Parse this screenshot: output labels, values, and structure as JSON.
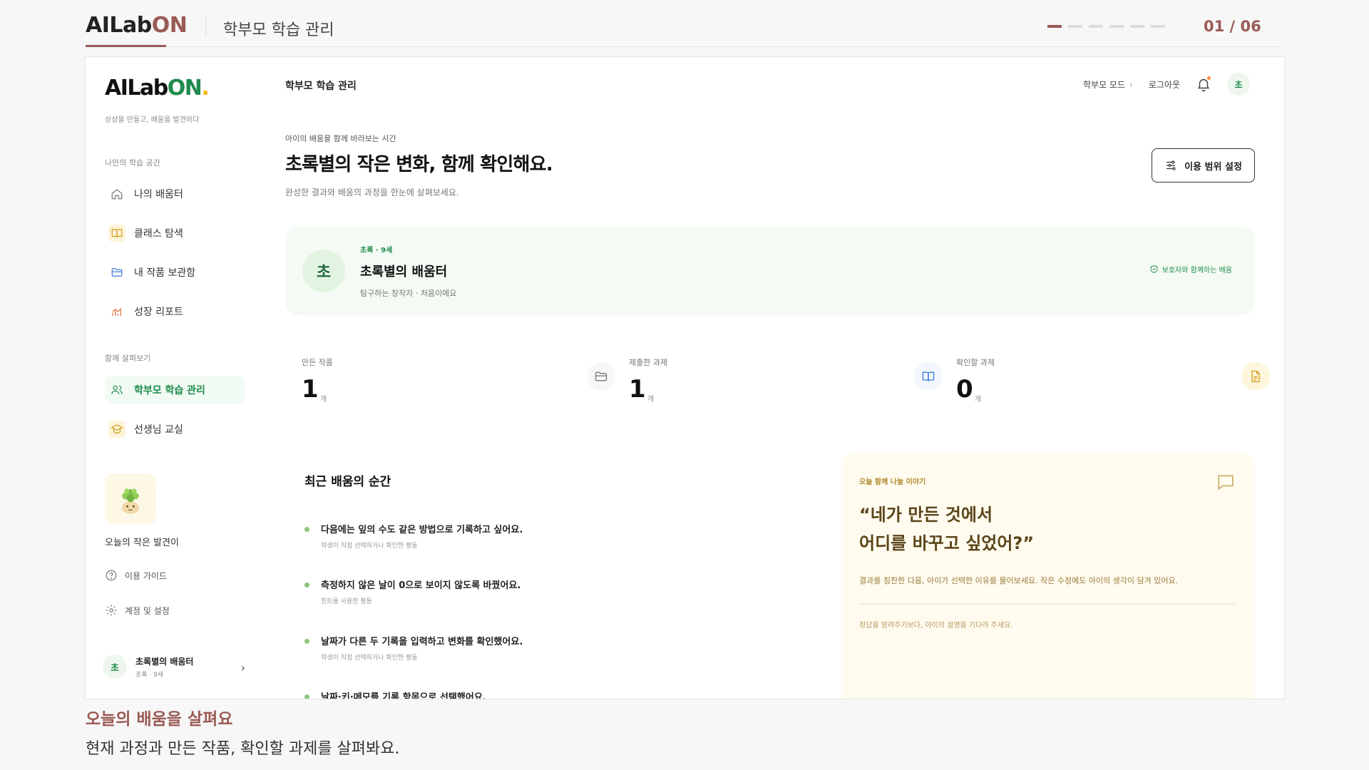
{
  "deck": {
    "brand_prefix": "AILab",
    "brand_suffix": "ON",
    "title": "학부모 학습 관리",
    "page_indicator": "01 / 06",
    "total_pages": 6,
    "current_page": 1
  },
  "sidebar": {
    "logo_prefix": "AILab",
    "logo_suffix": "ON",
    "logo_dot": ".",
    "tagline": "상상을 만들고, 배움을 발견하다",
    "section1_label": "나만의 학습 공간",
    "section2_label": "함께 살펴보기",
    "items": [
      {
        "label": "나의 배움터",
        "icon": "home-icon"
      },
      {
        "label": "클래스 탐색",
        "icon": "book-icon"
      },
      {
        "label": "내 작품 보관함",
        "icon": "folder-icon"
      },
      {
        "label": "성장 리포트",
        "icon": "chart-icon"
      },
      {
        "label": "학부모 학습 관리",
        "icon": "users-icon",
        "active": true
      },
      {
        "label": "선생님 교실",
        "icon": "graduation-cap-icon"
      }
    ],
    "discovery_label": "오늘의 작은 발견이",
    "guide_label": "이용 가이드",
    "settings_label": "계정 및 설정",
    "profile": {
      "avatar": "초",
      "name": "초록별의 배움터",
      "sub": "초록 · 9세"
    }
  },
  "topbar": {
    "title": "학부모 학습 관리",
    "mode_label": "학부모 모드",
    "logout_label": "로그아웃",
    "avatar": "초"
  },
  "hero": {
    "eyebrow": "아이의 배움을 함께 바라보는 시간",
    "headline": "초록별의 작은 변화, 함께 확인해요.",
    "subline": "완성한 결과와 배움의 과정을 한눈에 살펴보세요.",
    "scope_button": "이용 범위 설정"
  },
  "child": {
    "avatar": "초",
    "meta": "초록 · 9세",
    "name": "초록별의 배움터",
    "desc": "탐구하는 창작자 · 처음이에요",
    "badge": "보호자와 함께하는 배움"
  },
  "stats": [
    {
      "label": "만든 작품",
      "value": "1",
      "unit": "개",
      "icon": "folder-icon"
    },
    {
      "label": "제출한 과제",
      "value": "1",
      "unit": "개",
      "icon": "book-icon"
    },
    {
      "label": "확인할 과제",
      "value": "0",
      "unit": "개",
      "icon": "document-icon"
    }
  ],
  "recent": {
    "title": "최근 배움의 순간",
    "items": [
      {
        "text": "다음에는 잎의 수도 같은 방법으로 기록하고 싶어요.",
        "sub": "학생이 직접 선택하거나 확인한 활동"
      },
      {
        "text": "측정하지 않은 날이 0으로 보이지 않도록 바꿨어요.",
        "sub": "힌트를 사용한 활동"
      },
      {
        "text": "날짜가 다른 두 기록을 입력하고 변화를 확인했어요.",
        "sub": "학생이 직접 선택하거나 확인한 활동"
      },
      {
        "text": "날짜·키·메모를 기록 항목으로 선택했어요.",
        "sub": ""
      }
    ]
  },
  "talk": {
    "eyebrow": "오늘 함께 나눌 이야기",
    "quote_line1": "“네가 만든 것에서",
    "quote_line2": "어디를 바꾸고 싶었어?”",
    "body": "결과를 칭찬한 다음, 아이가 선택한 이유를 물어보세요. 작은 수정에도 아이의 생각이 담겨 있어요.",
    "foot": "정답을 알려주기보다, 아이의 설명을 기다려 주세요."
  },
  "caption": {
    "title": "오늘의 배움을 살펴요",
    "sub": "현재 과정과 만든 작품, 확인할 과제를 살펴봐요."
  },
  "colors": {
    "accent": "#9a5a55",
    "green": "#1e8b4c",
    "yellow": "#f2b600"
  }
}
